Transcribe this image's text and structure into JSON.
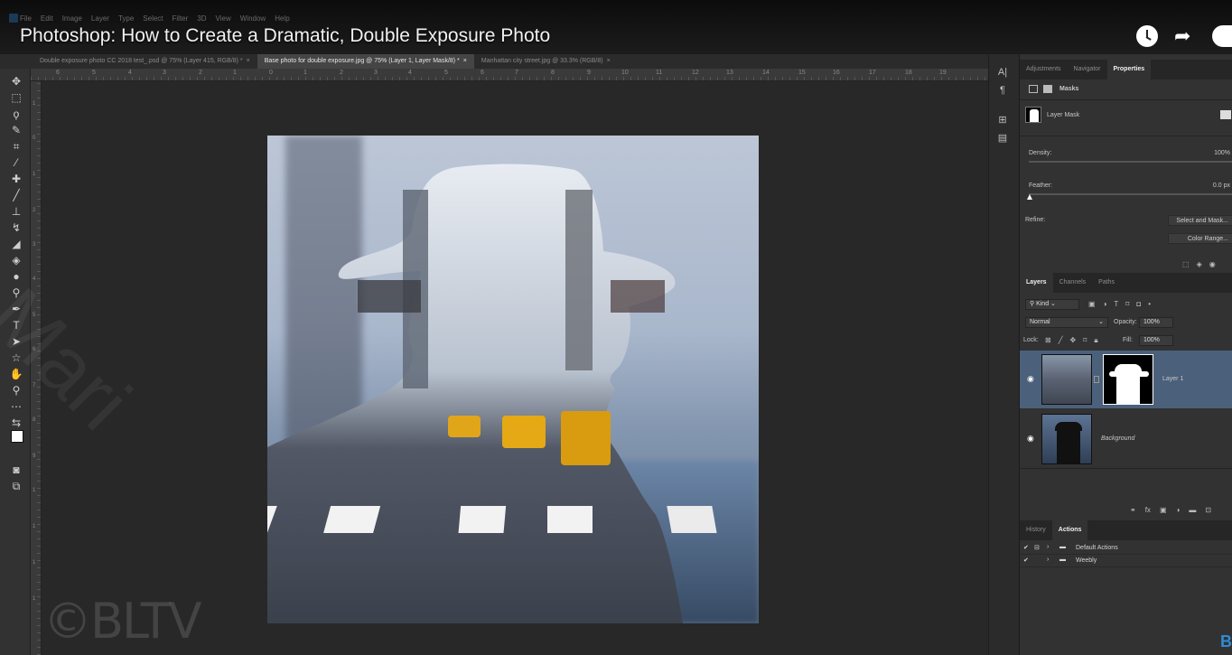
{
  "window": {
    "video_title": "Photoshop: How to Create a Dramatic, Double Exposure Photo",
    "menu": [
      "File",
      "Edit",
      "Image",
      "Layer",
      "Type",
      "Select",
      "Filter",
      "3D",
      "View",
      "Window",
      "Help"
    ]
  },
  "tabs": [
    {
      "label": "Double exposure photo CC 2018 test_.psd @ 75% (Layer 415, RGB/8) *",
      "active": false
    },
    {
      "label": "Base photo for double exposure.jpg @ 75% (Layer 1, Layer Mask/8) *",
      "active": true
    },
    {
      "label": "Manhattan city street.jpg @ 33.3% (RGB/8)",
      "active": false
    }
  ],
  "ruler": {
    "h_marks": [
      "6",
      "5",
      "4",
      "3",
      "2",
      "1",
      "0",
      "1",
      "2",
      "3",
      "4",
      "5",
      "6",
      "7",
      "8",
      "9",
      "10",
      "11",
      "12",
      "13",
      "14",
      "15",
      "16",
      "17",
      "18",
      "19"
    ],
    "v_marks": [
      "1",
      "0",
      "1",
      "2",
      "3",
      "4",
      "5",
      "6",
      "7",
      "8",
      "9",
      "1",
      "1",
      "1",
      "1"
    ]
  },
  "tools": [
    "move-tool",
    "marquee-tool",
    "lasso-tool",
    "quick-select-tool",
    "crop-tool",
    "eyedropper-tool",
    "healing-tool",
    "brush-tool",
    "stamp-tool",
    "history-brush-tool",
    "eraser-tool",
    "gradient-tool",
    "blur-tool",
    "dodge-tool",
    "pen-tool",
    "type-tool",
    "path-select-tool",
    "shape-tool",
    "hand-tool",
    "zoom-tool",
    "more-tools",
    "swap-colors",
    "foreground-color",
    "quick-mask",
    "screen-mode"
  ],
  "watermark": "©BLTV",
  "properties": {
    "tabs": [
      "Adjustments",
      "Navigator",
      "Properties"
    ],
    "active_tab": "Properties",
    "section_title": "Masks",
    "mask_label": "Layer Mask",
    "density_label": "Density:",
    "density_value": "100%",
    "feather_label": "Feather:",
    "feather_value": "0.0 px",
    "refine_label": "Refine:",
    "select_mask_btn": "Select and Mask...",
    "color_range_btn": "Color Range..."
  },
  "layers": {
    "tabs": [
      "Layers",
      "Channels",
      "Paths"
    ],
    "active_tab": "Layers",
    "filter_kind": "Kind",
    "blend_mode": "Normal",
    "opacity_label": "Opacity:",
    "opacity_value": "100%",
    "lock_label": "Lock:",
    "fill_label": "Fill:",
    "fill_value": "100%",
    "items": [
      {
        "name": "Layer 1",
        "selected": true
      },
      {
        "name": "Background",
        "selected": false
      }
    ]
  },
  "history": {
    "tabs": [
      "History",
      "Actions"
    ],
    "active_tab": "Actions",
    "actions": [
      "Default Actions",
      "Weebly"
    ]
  },
  "colors": {
    "accent": "#4b607a",
    "panel": "#323232",
    "canvas": "#282828"
  }
}
